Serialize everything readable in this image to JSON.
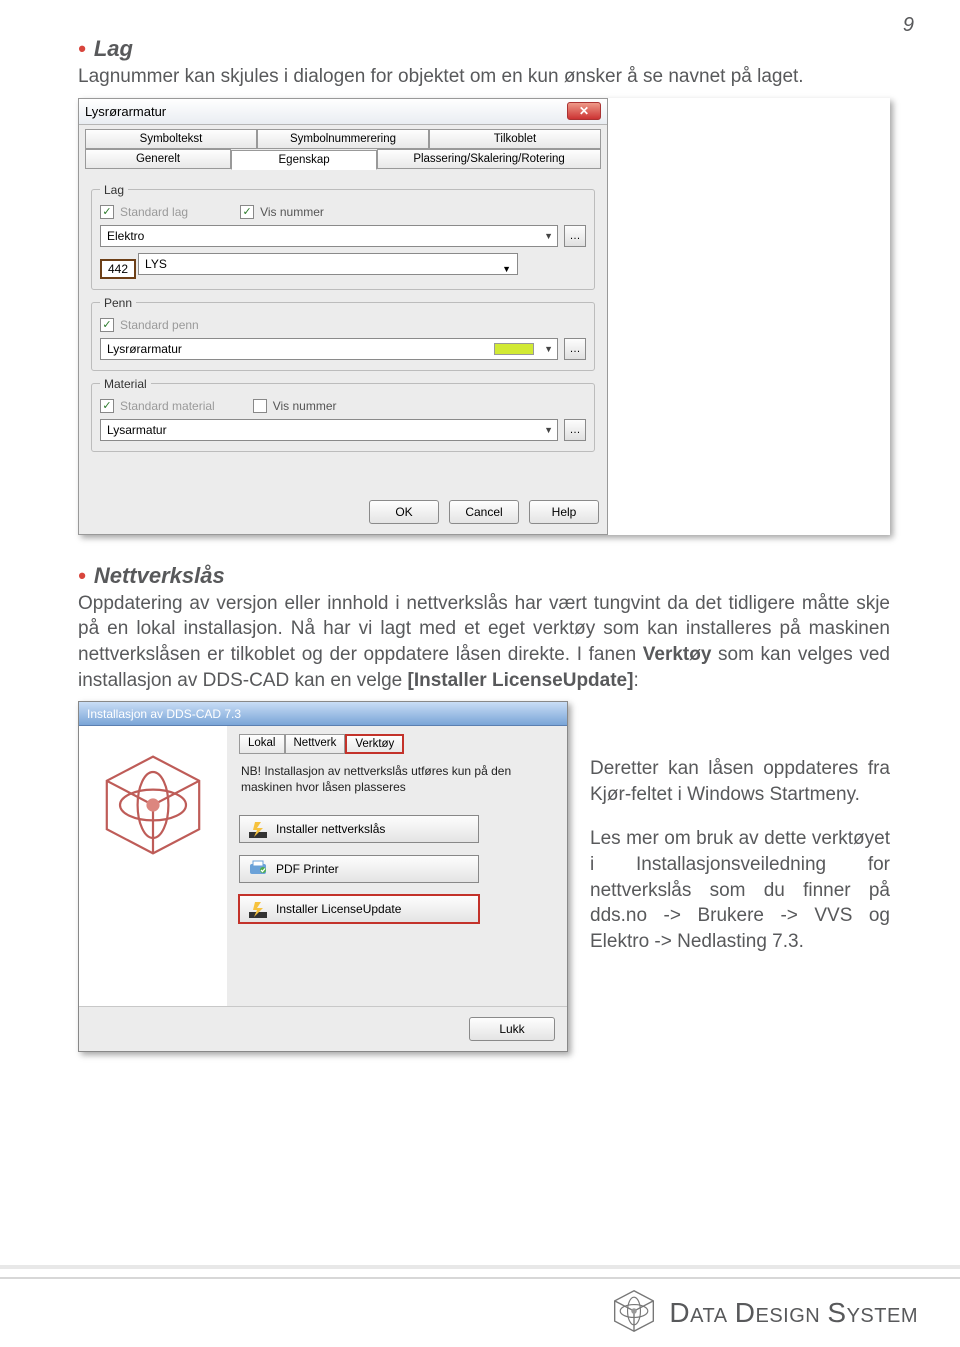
{
  "page_number": "9",
  "sections": {
    "lag": {
      "heading": "Lag",
      "text": "Lagnummer kan skjules i dialogen for objektet om en kun ønsker å se navnet på laget."
    },
    "nett": {
      "heading": "Nettverkslås",
      "p1_a": "Oppdatering av versjon eller innhold i nettverkslås har vært tungvint da det tidligere måtte skje på en lokal installasjon. Nå har vi lagt med et eget verktøy som kan installeres på maskinen nettverkslåsen er tilkoblet og der oppdatere låsen direkte.  I fanen ",
      "p1_bold1": "Verktøy",
      "p1_b": " som kan velges ved installasjon av DDS-CAD kan en velge ",
      "p1_bold2": "[Installer LicenseUpdate]",
      "p1_c": ":"
    },
    "side": {
      "p1": "Deretter kan låsen oppdateres fra Kjør-feltet i Windows Startmeny.",
      "p2_a": "Les mer om bruk av dette verktøyet i ",
      "p2_ital": "Installasjonsveiledning for nettverkslås",
      "p2_b": " som du finner på ",
      "p2_bold": "dds.no -> Brukere -> VVS og Elektro -> Nedlasting 7.3."
    }
  },
  "dialog1": {
    "title": "Lysrørarmatur",
    "tabs_top": [
      "Symboltekst",
      "Symbolnummerering",
      "Tilkoblet"
    ],
    "tabs_bottom": [
      "Generelt",
      "Egenskap",
      "Plassering/Skalering/Rotering"
    ],
    "lag": {
      "legend": "Lag",
      "chk_std": "Standard lag",
      "chk_vis": "Vis nummer",
      "dd1": "Elektro",
      "num": "442",
      "lys": "LYS"
    },
    "penn": {
      "legend": "Penn",
      "chk_std": "Standard penn",
      "dd": "Lysrørarmatur"
    },
    "material": {
      "legend": "Material",
      "chk_std": "Standard material",
      "chk_vis": "Vis nummer",
      "dd": "Lysarmatur"
    },
    "buttons": {
      "ok": "OK",
      "cancel": "Cancel",
      "help": "Help"
    }
  },
  "dialog2": {
    "title": "Installasjon av DDS-CAD 7.3",
    "tabs": [
      "Lokal",
      "Nettverk",
      "Verktøy"
    ],
    "nb": "NB! Installasjon av nettverkslås utføres kun på den maskinen hvor låsen plasseres",
    "btn1": "Installer nettverkslås",
    "btn2": "PDF Printer",
    "btn3": "Installer LicenseUpdate",
    "close": "Lukk"
  },
  "footer": {
    "brand": "Data Design System"
  }
}
